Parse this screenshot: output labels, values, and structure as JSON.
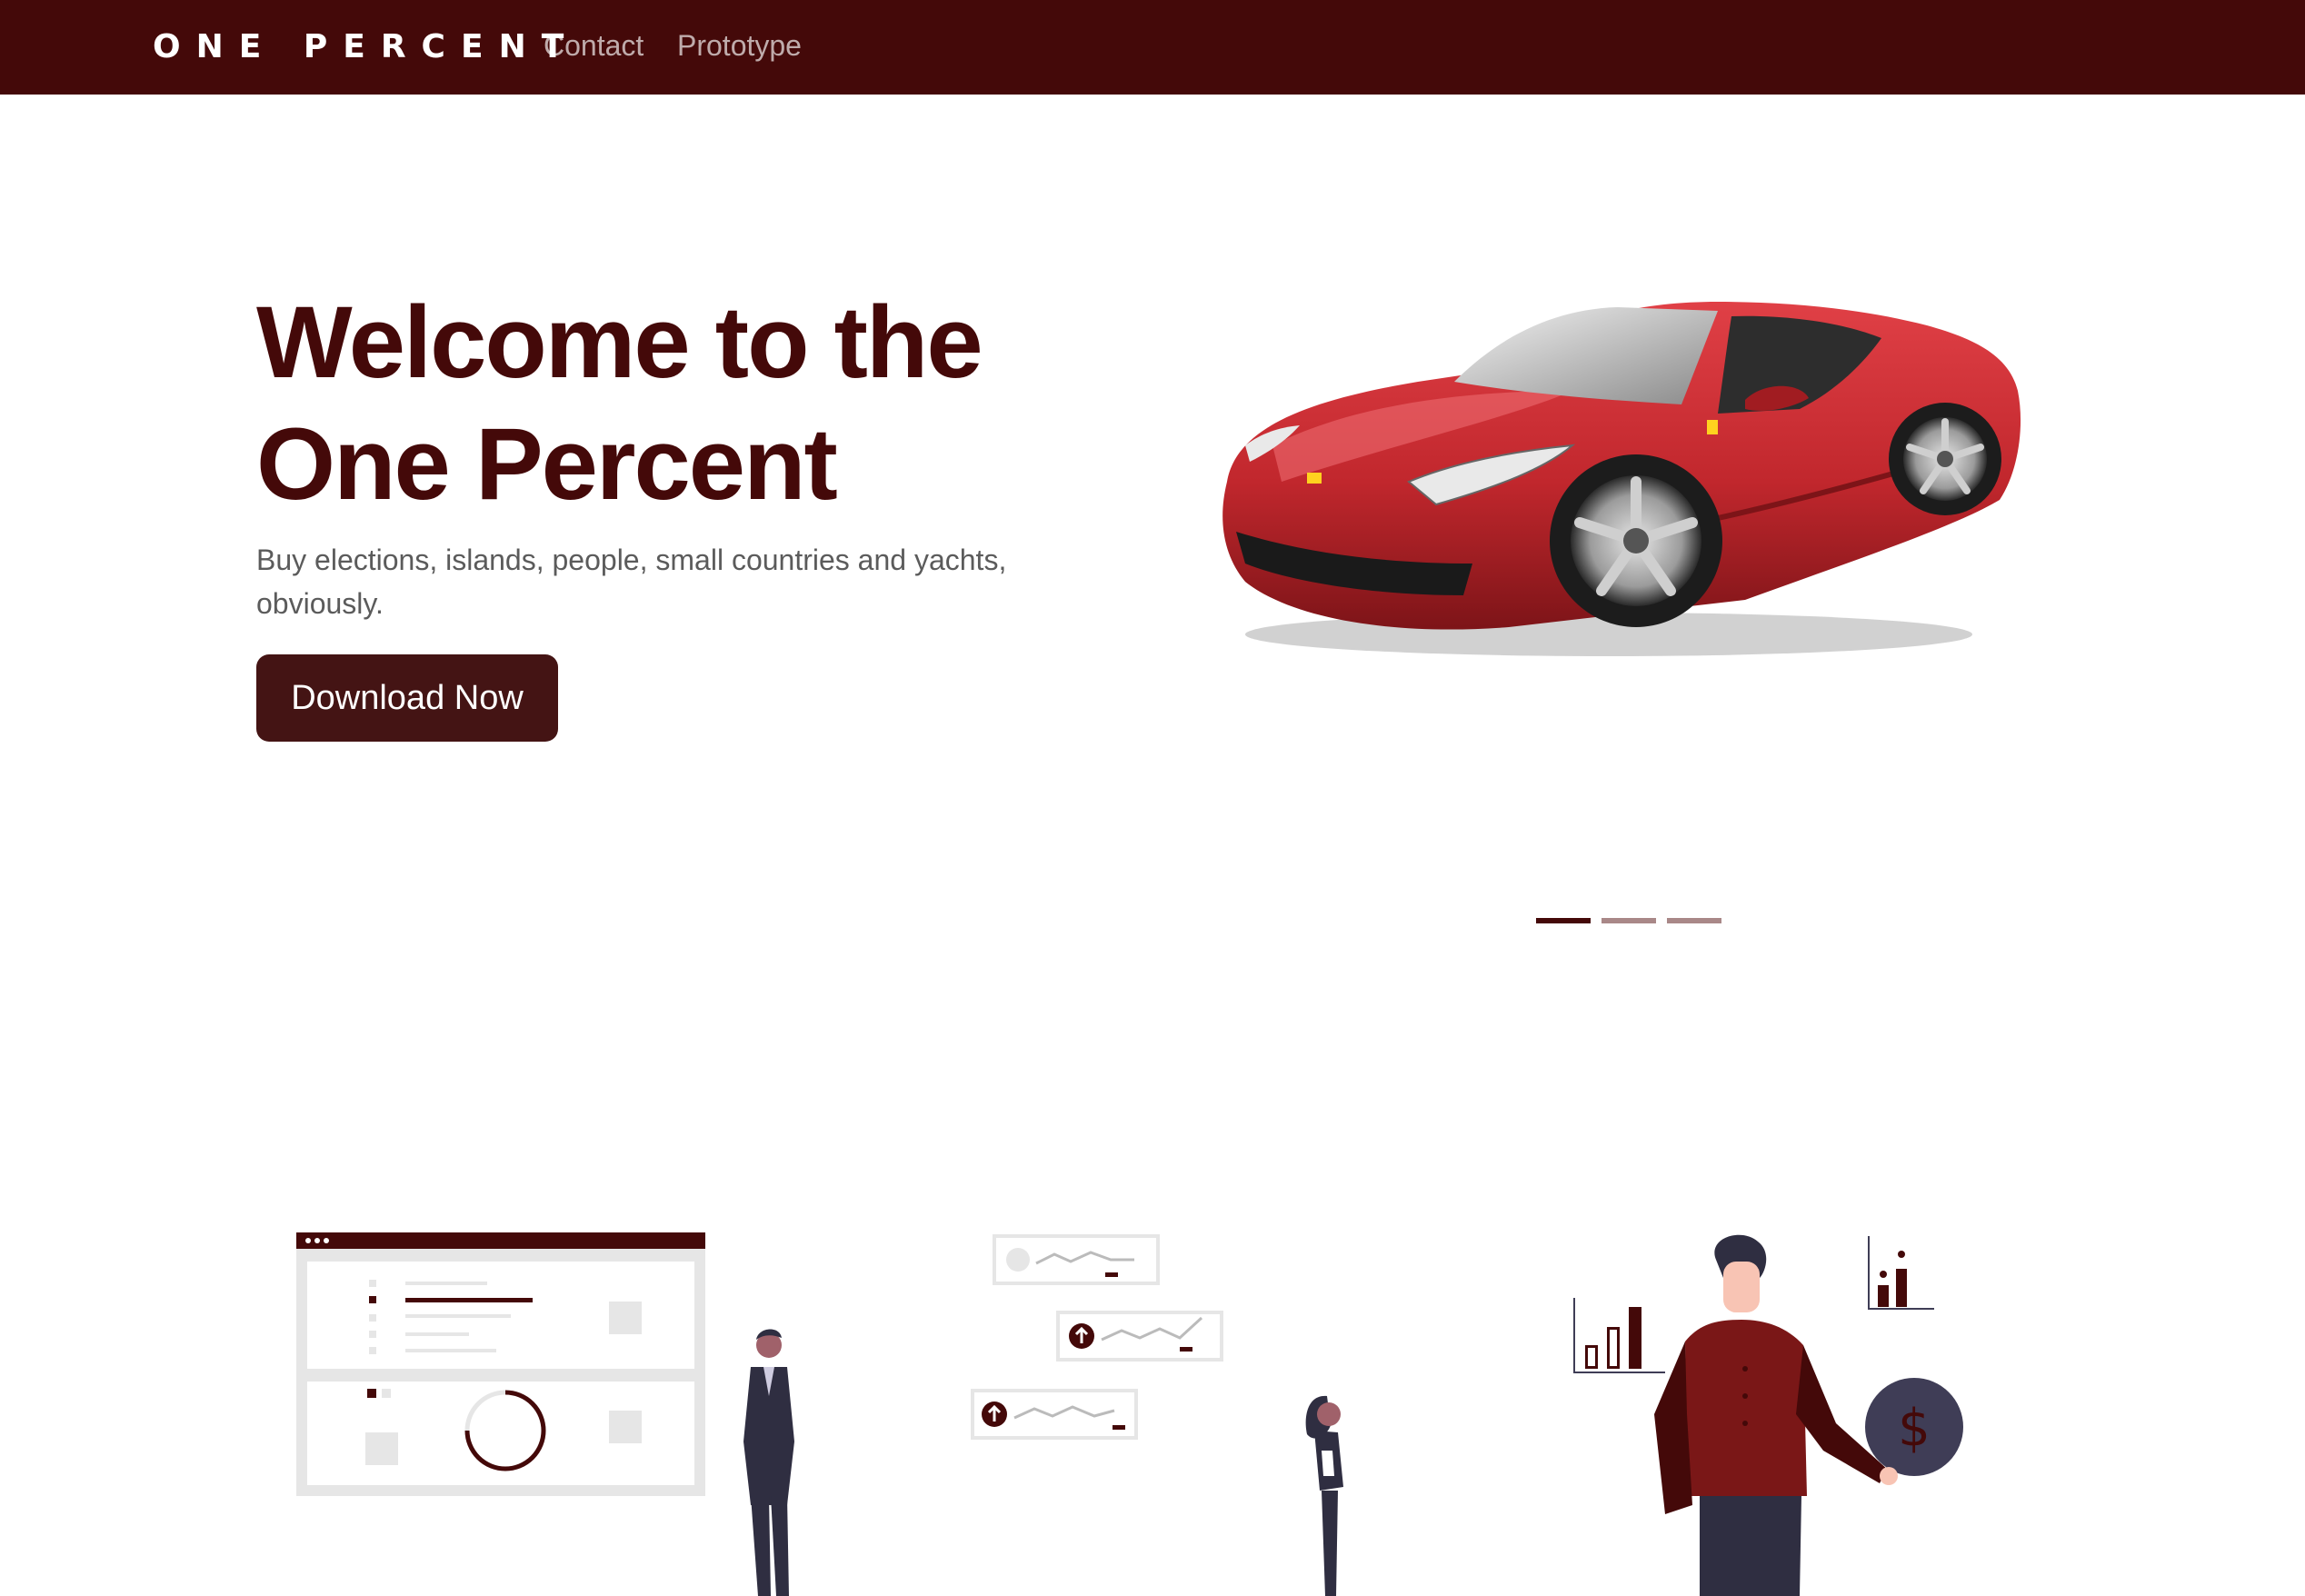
{
  "navbar": {
    "brand": "ONE PERCENT",
    "links": [
      {
        "label": "Contact"
      },
      {
        "label": "Prototype"
      }
    ]
  },
  "hero": {
    "title_line1": "Welcome to the",
    "title_line2": "One Percent",
    "subtitle_line1": "Buy elections, islands, people, small countries and yachts,",
    "subtitle_line2": "obviously.",
    "cta_label": "Download Now"
  },
  "carousel": {
    "active_index": 0,
    "slide_count": 3
  },
  "illustrations": [
    {
      "icon": "dashboard-person-illustration"
    },
    {
      "icon": "stock-cards-woman-illustration"
    },
    {
      "icon": "finance-man-illustration"
    }
  ],
  "colors": {
    "brand": "#440909",
    "button": "#441414",
    "accent_red": "#c1272d",
    "indicator_inactive": "#a98888"
  }
}
